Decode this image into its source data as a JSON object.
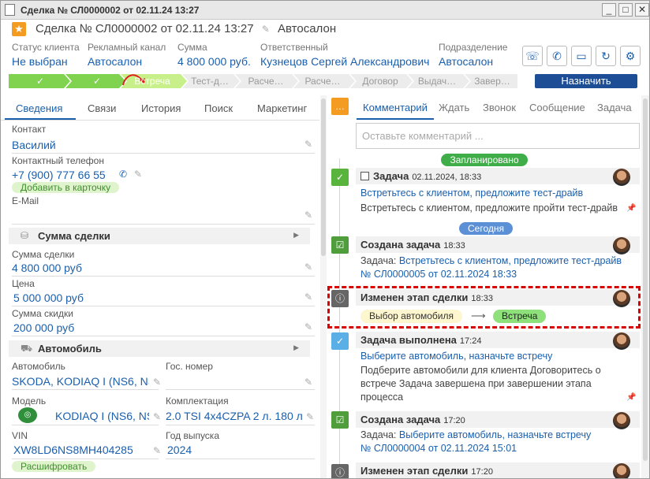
{
  "window": {
    "title": "Сделка № СЛ0000002 от 02.11.24 13:27",
    "minimize": "_",
    "maximize": "□",
    "close": "✕"
  },
  "header": {
    "title": "Сделка № СЛ0000002 от 02.11.24 13:27",
    "subtitle": "Автосалон"
  },
  "fields": {
    "client_status": {
      "label": "Статус клиента",
      "value": "Не выбран"
    },
    "ad_channel": {
      "label": "Рекламный канал",
      "value": "Автосалон"
    },
    "amount": {
      "label": "Сумма",
      "value": "4 800 000 руб."
    },
    "responsible": {
      "label": "Ответственный",
      "value": "Кузнецов Сергей Александрович"
    },
    "department": {
      "label": "Подразделение",
      "value": "Автосалон"
    }
  },
  "stages": [
    "Встреча",
    "Тест-д…",
    "Расче…",
    "Расче…",
    "Договор",
    "Выдач…",
    "Завер…"
  ],
  "stage_check": "✓",
  "assign_button": "Назначить",
  "left_tabs": [
    "Сведения",
    "Связи",
    "История",
    "Поиск",
    "Маркетинг"
  ],
  "contact": {
    "label": "Контакт",
    "value": "Василий",
    "phone_label": "Контактный телефон",
    "phone": "+7 (900) 777 66 55",
    "add_card": "Добавить в карточку",
    "email_label": "E-Mail"
  },
  "deal_sum": {
    "section": "Сумма сделки",
    "sum_label": "Сумма сделки",
    "sum_value": "4 800 000 руб",
    "price_label": "Цена",
    "price_value": "5 000 000 руб",
    "discount_label": "Сумма скидки",
    "discount_value": "200 000 руб"
  },
  "car": {
    "section": "Автомобиль",
    "car_label": "Автомобиль",
    "car_value": "SKODA, KODIAQ I (NS6, NS",
    "plate_label": "Гос. номер",
    "model_label": "Модель",
    "model_value": "KODIAQ I (NS6, NS",
    "trim_label": "Комплектация",
    "trim_value": "2.0 TSI 4x4CZPA 2 л. 180 л",
    "vin_label": "VIN",
    "vin_value": "XW8LD6NS8MH404285",
    "year_label": "Год выпуска",
    "year_value": "2024",
    "decode": "Расшифровать"
  },
  "right_tabs": [
    "Комментарий",
    "Ждать",
    "Звонок",
    "Сообщение",
    "Задача"
  ],
  "comment_placeholder": "Оставьте комментарий ...",
  "timeline": {
    "planned": "Запланировано",
    "today": "Сегодня",
    "events": [
      {
        "title": "Задача",
        "time": "02.11.2024, 18:33",
        "line1": "Встретьтесь с клиентом, предложите тест-драйв",
        "line2": "Встретьтесь с клиентом, предложите пройти тест-драйв"
      },
      {
        "title": "Создана задача",
        "time": "18:33",
        "line1_prefix": "Задача: ",
        "line1": "Встретьтесь с клиентом, предложите тест-драйв",
        "line2": "№ СЛ0000005 от 02.11.2024 18:33"
      },
      {
        "title": "Изменен этап сделки",
        "time": "18:33",
        "from": "Выбор автомобиля",
        "arrow": "⟶",
        "to": "Встреча"
      },
      {
        "title": "Задача выполнена",
        "time": "17:24",
        "line1": "Выберите автомобиль, назначьте встречу",
        "line2": "Подберите автомобили для клиента Договоритесь о",
        "line3": "встрече Задача завершена при завершении этапа",
        "line4": "процесса"
      },
      {
        "title": "Создана задача",
        "time": "17:20",
        "line1_prefix": "Задача: ",
        "line1": "Выберите автомобиль, назначьте встречу",
        "line2": "№ СЛ0000004 от 02.11.2024 15:01"
      },
      {
        "title": "Изменен этап сделки",
        "time": "17:20"
      }
    ]
  },
  "colors": {
    "accent": "#1a5fad",
    "stage_done": "#7fd34e",
    "stage_current": "#c8f08a",
    "assign": "#1d4d94",
    "highlight": "#d80000"
  }
}
